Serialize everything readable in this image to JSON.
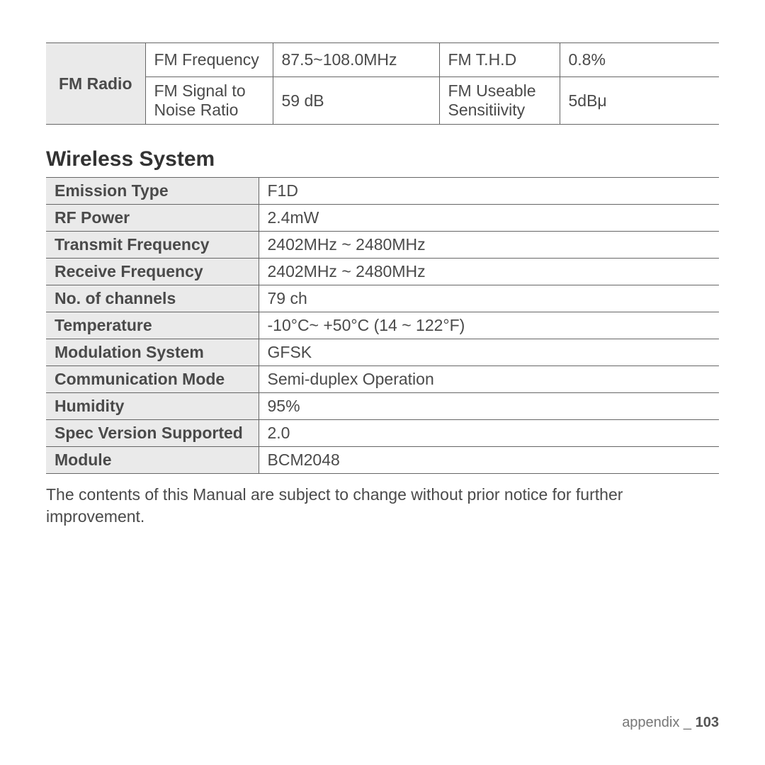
{
  "fm_radio": {
    "header": "FM Radio",
    "rows": [
      {
        "l1": "FM Frequency",
        "v1": "87.5~108.0MHz",
        "l2": "FM T.H.D",
        "v2": "0.8%"
      },
      {
        "l1": "FM Signal to Noise Ratio",
        "v1": "59 dB",
        "l2": "FM Useable Sensitiivity",
        "v2": "5dBμ"
      }
    ]
  },
  "wireless": {
    "heading": "Wireless System",
    "rows": [
      {
        "label": "Emission Type",
        "value": "F1D"
      },
      {
        "label": "RF Power",
        "value": "2.4mW"
      },
      {
        "label": "Transmit Frequency",
        "value": "2402MHz ~ 2480MHz"
      },
      {
        "label": "Receive Frequency",
        "value": "2402MHz ~ 2480MHz"
      },
      {
        "label": "No. of channels",
        "value": "79 ch"
      },
      {
        "label": "Temperature",
        "value": "-10°C~ +50°C (14 ~ 122°F)"
      },
      {
        "label": "Modulation System",
        "value": "GFSK"
      },
      {
        "label": "Communication Mode",
        "value": "Semi-duplex Operation"
      },
      {
        "label": "Humidity",
        "value": "95%"
      },
      {
        "label": "Spec Version Supported",
        "value": "2.0"
      },
      {
        "label": "Module",
        "value": "BCM2048"
      }
    ]
  },
  "note": "The contents of this Manual are subject to change without prior notice for further improvement.",
  "footer": {
    "section": "appendix _",
    "page": "103"
  }
}
